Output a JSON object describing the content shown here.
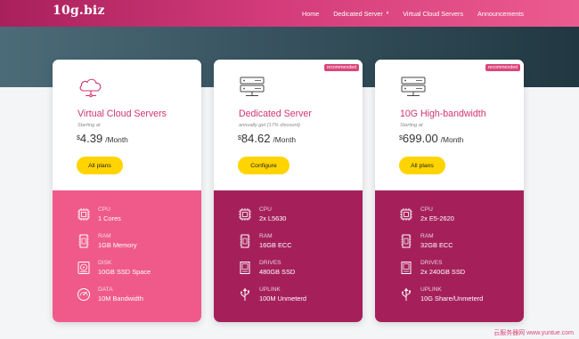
{
  "header": {
    "logo": "10g.biz",
    "nav": [
      {
        "label": "Home"
      },
      {
        "label": "Dedicated Server",
        "caret": "▾"
      },
      {
        "label": "Virtual Cloud Servers"
      },
      {
        "label": "Announcements"
      }
    ]
  },
  "plans": [
    {
      "title": "Virtual Cloud Servers",
      "subtitle": "Starting at",
      "currency": "$",
      "price": "4.39",
      "period": "/Month",
      "button": "All plans",
      "icon": "cloud-icon",
      "badge": "",
      "specs": [
        {
          "label": "CPU",
          "value": "1 Cores",
          "icon": "cpu-icon"
        },
        {
          "label": "RAM",
          "value": "1GB Memory",
          "icon": "ram-icon"
        },
        {
          "label": "DISK",
          "value": "10GB SSD Space",
          "icon": "disk-icon"
        },
        {
          "label": "DATA",
          "value": "10M Bandwidth",
          "icon": "speedometer-icon"
        }
      ]
    },
    {
      "title": "Dedicated Server",
      "subtitle": "annually get (17% discount)",
      "currency": "$",
      "price": "84.62",
      "period": "/Month",
      "button": "Configure",
      "icon": "server-icon",
      "badge": "recommended",
      "specs": [
        {
          "label": "CPU",
          "value": "2x L5630",
          "icon": "cpu-icon"
        },
        {
          "label": "RAM",
          "value": "16GB ECC",
          "icon": "ram-icon"
        },
        {
          "label": "DRIVES",
          "value": "480GB SSD",
          "icon": "drive-icon"
        },
        {
          "label": "UPLINK",
          "value": "100M Unmeterd",
          "icon": "usb-icon"
        }
      ]
    },
    {
      "title": "10G High-bandwidth",
      "subtitle": "Starting at",
      "currency": "$",
      "price": "699.00",
      "period": "/Month",
      "button": "All plans",
      "icon": "server-icon",
      "badge": "recommended",
      "specs": [
        {
          "label": "CPU",
          "value": "2x E5-2620",
          "icon": "cpu-icon"
        },
        {
          "label": "RAM",
          "value": "32GB ECC",
          "icon": "ram-icon"
        },
        {
          "label": "DRIVES",
          "value": "2x 240GB SSD",
          "icon": "drive-icon"
        },
        {
          "label": "UPLINK",
          "value": "10G Share/Unmeterd",
          "icon": "usb-icon"
        }
      ]
    }
  ],
  "watermark": "云服务器网 www.yuntue.com",
  "colors": {
    "accent_pink": "#ef5a8b",
    "accent_magenta": "#a5205b",
    "title_pink": "#d2336e",
    "button_yellow": "#ffd400"
  }
}
